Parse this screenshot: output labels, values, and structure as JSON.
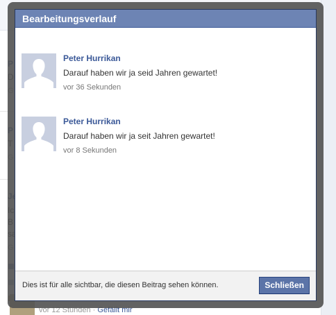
{
  "background": {
    "fragments": [
      "P",
      "D",
      "G",
      "P",
      "T",
      "G",
      "Je",
      "Ic",
      "B",
      "sa",
      "G"
    ],
    "bottom_time": "vor 12 Stunden",
    "bottom_separator": " · ",
    "bottom_link": "Gefällt mir"
  },
  "dialog": {
    "title": "Bearbeitungsverlauf",
    "entries": [
      {
        "name": "Peter Hurrikan",
        "text": "Darauf haben wir ja seid Jahren gewartet!",
        "time": "vor 36 Sekunden"
      },
      {
        "name": "Peter Hurrikan",
        "text": "Darauf haben wir ja seit Jahren gewartet!",
        "time": "vor 8 Sekunden"
      }
    ],
    "footer_text": "Dies ist für alle sichtbar, die diesen Beitrag sehen können.",
    "close_label": "Schließen"
  },
  "colors": {
    "header_bg": "#6d84b4",
    "name_link": "#3b5998",
    "button_bg": "#5b74a8"
  },
  "icons": {
    "avatar": "default-profile-silhouette-icon"
  }
}
